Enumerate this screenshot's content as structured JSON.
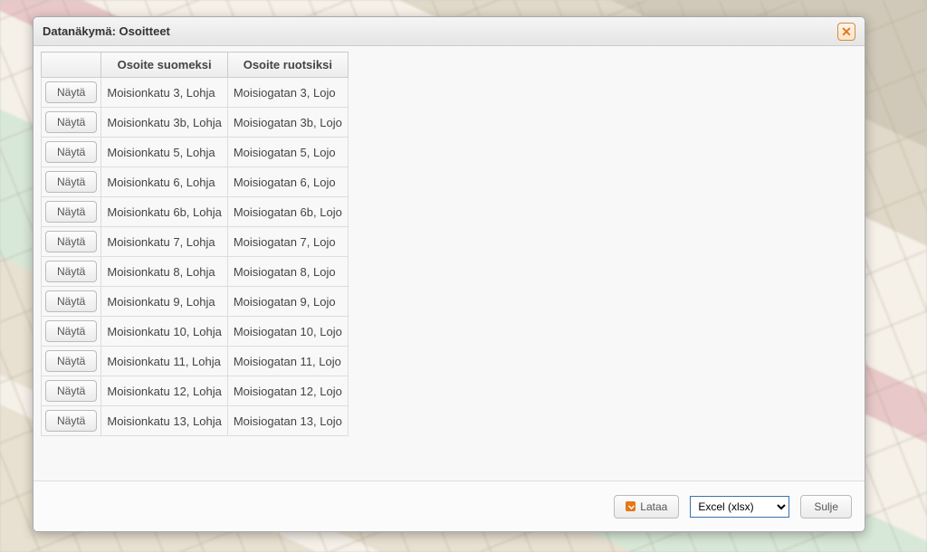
{
  "dialog": {
    "title": "Datanäkymä: Osoitteet"
  },
  "table": {
    "headers": {
      "col_action": "",
      "col_fi": "Osoite suomeksi",
      "col_sv": "Osoite ruotsiksi"
    },
    "show_label": "Näytä",
    "rows": [
      {
        "fi": "Moisionkatu 3, Lohja",
        "sv": "Moisiogatan 3, Lojo"
      },
      {
        "fi": "Moisionkatu 3b, Lohja",
        "sv": "Moisiogatan 3b, Lojo"
      },
      {
        "fi": "Moisionkatu 5, Lohja",
        "sv": "Moisiogatan 5, Lojo"
      },
      {
        "fi": "Moisionkatu 6, Lohja",
        "sv": "Moisiogatan 6, Lojo"
      },
      {
        "fi": "Moisionkatu 6b, Lohja",
        "sv": "Moisiogatan 6b, Lojo"
      },
      {
        "fi": "Moisionkatu 7, Lohja",
        "sv": "Moisiogatan 7, Lojo"
      },
      {
        "fi": "Moisionkatu 8, Lohja",
        "sv": "Moisiogatan 8, Lojo"
      },
      {
        "fi": "Moisionkatu 9, Lohja",
        "sv": "Moisiogatan 9, Lojo"
      },
      {
        "fi": "Moisionkatu 10, Lohja",
        "sv": "Moisiogatan 10, Lojo"
      },
      {
        "fi": "Moisionkatu 11, Lohja",
        "sv": "Moisiogatan 11, Lojo"
      },
      {
        "fi": "Moisionkatu 12, Lohja",
        "sv": "Moisiogatan 12, Lojo"
      },
      {
        "fi": "Moisionkatu 13, Lohja",
        "sv": "Moisiogatan 13, Lojo"
      }
    ]
  },
  "footer": {
    "download_label": "Lataa",
    "format_selected": "Excel (xlsx)",
    "close_label": "Sulje"
  }
}
